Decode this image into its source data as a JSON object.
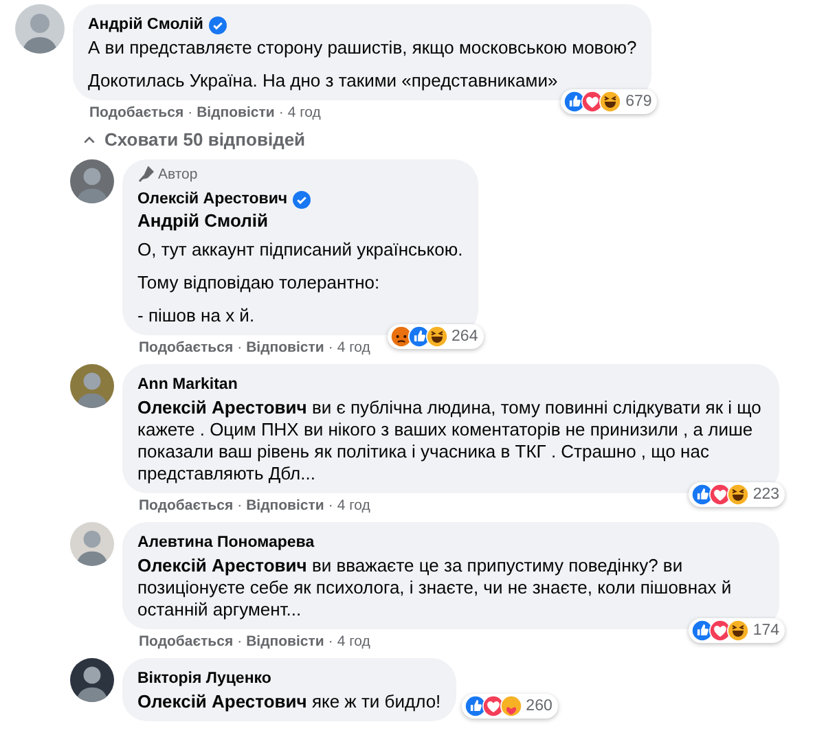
{
  "comment": {
    "author": "Андрій Смолій",
    "verified": true,
    "paragraphs": [
      "А ви представляєте сторону рашистів, якщо московською мовою?",
      "Докотилась Україна. На дно з такими «представниками»"
    ],
    "reactions": [
      {
        "kind": "like"
      },
      {
        "kind": "love"
      },
      {
        "kind": "haha"
      }
    ],
    "reaction_count": "679",
    "actions": [
      "Подобається",
      "Відповісти",
      "4 год"
    ],
    "separator": "·"
  },
  "hide_replies": "Сховати 50 відповідей",
  "replies": [
    {
      "author": "Олексій Арестович",
      "verified": true,
      "author_badge": "Автор",
      "mention": "Андрій Смолій",
      "mention_on_own_line": true,
      "paragraphs": [
        "О, тут аккаунт підписаний українською.",
        "Тому відповідаю толерантно:",
        "- пішов на х й."
      ],
      "reactions": [
        {
          "kind": "angry"
        },
        {
          "kind": "like"
        },
        {
          "kind": "haha"
        }
      ],
      "reaction_count": "264",
      "actions": [
        "Подобається",
        "Відповісти",
        "4 год"
      ],
      "separator": "·"
    },
    {
      "author": "Ann Markitan",
      "verified": false,
      "mention": "Олексій Арестович",
      "mention_on_own_line": false,
      "paragraphs": [
        "ви є публічна людина, тому повинні слідкувати як і що кажете . Оцим ПНХ ви нікого з ваших коментаторів не принизили , а лише показали ваш рівень як політика і учасника в ТКГ . Страшно , що нас представляють Дбл..."
      ],
      "reactions": [
        {
          "kind": "like"
        },
        {
          "kind": "love"
        },
        {
          "kind": "haha"
        }
      ],
      "reaction_count": "223",
      "actions": [
        "Подобається",
        "Відповісти",
        "4 год"
      ],
      "separator": "·"
    },
    {
      "author": "Алевтина Пономарева",
      "verified": false,
      "mention": "Олексій Арестович",
      "mention_on_own_line": false,
      "paragraphs": [
        "ви вважаєте це за припустиму поведінку? ви позиціонуєте себе як психолога, і знаєте, чи не знаєте, коли пішовнах й останній аргумент..."
      ],
      "reactions": [
        {
          "kind": "like"
        },
        {
          "kind": "love"
        },
        {
          "kind": "haha"
        }
      ],
      "reaction_count": "174",
      "actions": [
        "Подобається",
        "Відповісти",
        "4 год"
      ],
      "separator": "·"
    },
    {
      "author": "Вікторія Луценко",
      "verified": false,
      "mention": "Олексій Арестович",
      "mention_on_own_line": false,
      "paragraphs": [
        "яке ж ти бидло!"
      ],
      "reactions": [
        {
          "kind": "like"
        },
        {
          "kind": "love"
        },
        {
          "kind": "care"
        }
      ],
      "reaction_count": "260"
    }
  ]
}
